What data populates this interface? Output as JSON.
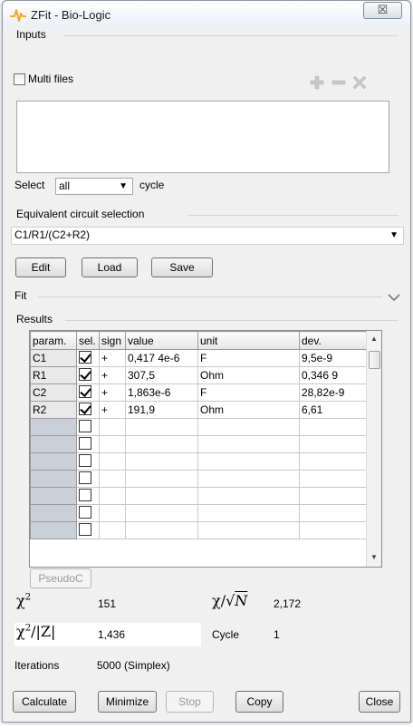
{
  "window": {
    "title": "ZFit - Bio-Logic",
    "close_glyph": "☒"
  },
  "inputs": {
    "section_label": "Inputs",
    "multi_files_label": "Multi files",
    "multi_files_checked": false,
    "select_label": "Select",
    "select_value": "all",
    "cycle_label": "cycle"
  },
  "circuit": {
    "section_label": "Equivalent circuit selection",
    "value": "C1/R1/(C2+R2)",
    "edit_label": "Edit",
    "load_label": "Load",
    "save_label": "Save"
  },
  "fit": {
    "section_label": "Fit"
  },
  "results": {
    "section_label": "Results",
    "columns": [
      "param.",
      "sel.",
      "sign",
      "value",
      "unit",
      "dev."
    ],
    "rows": [
      {
        "param": "C1",
        "sel": true,
        "sign": "+",
        "value": "0,417 4e-6",
        "unit": "F",
        "dev": "9,5e-9"
      },
      {
        "param": "R1",
        "sel": true,
        "sign": "+",
        "value": "307,5",
        "unit": "Ohm",
        "dev": "0,346 9"
      },
      {
        "param": "C2",
        "sel": true,
        "sign": "+",
        "value": "1,863e-6",
        "unit": "F",
        "dev": "28,82e-9"
      },
      {
        "param": "R2",
        "sel": true,
        "sign": "+",
        "value": "191,9",
        "unit": "Ohm",
        "dev": "6,61"
      }
    ],
    "empty_rows": 7,
    "pseudoc_label": "PseudoC"
  },
  "stats": {
    "chi2_value": "151",
    "chi_sqrt_n_value": "2,172",
    "chi2_z_value": "1,436",
    "cycle_label": "Cycle",
    "cycle_value": "1",
    "iterations_label": "Iterations",
    "iterations_value": "5000 (Simplex)"
  },
  "buttons": {
    "calculate": "Calculate",
    "minimize": "Minimize",
    "stop": "Stop",
    "copy": "Copy",
    "close": "Close"
  },
  "colors": {
    "window_bg": "#f0f0f0",
    "grid_row_header_empty": "#c9d0da",
    "icon_orange": "#f5a623"
  }
}
